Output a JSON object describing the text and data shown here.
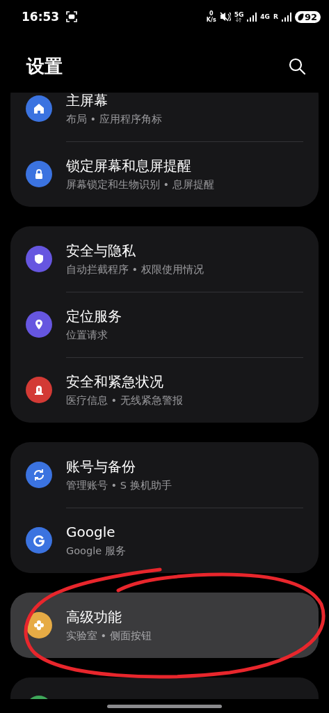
{
  "status_bar": {
    "time": "16:53",
    "speed_value": "0",
    "speed_unit": "K/s",
    "network_1": "5G",
    "network_2": "4G",
    "roaming": "R",
    "battery": "92"
  },
  "header": {
    "title": "设置"
  },
  "groups": [
    {
      "items": [
        {
          "title": "主屏幕",
          "subtitle": "布局 • 应用程序角标",
          "color": "#3b73e0",
          "selected": false
        },
        {
          "title": "锁定屏幕和息屏提醒",
          "subtitle": "屏幕锁定和生物识别 • 息屏提醒",
          "color": "#3b73e0",
          "selected": false
        }
      ]
    },
    {
      "items": [
        {
          "title": "安全与隐私",
          "subtitle": "自动拦截程序 • 权限使用情况",
          "color": "#6656e0",
          "selected": false
        },
        {
          "title": "定位服务",
          "subtitle": "位置请求",
          "color": "#6656e0",
          "selected": false
        },
        {
          "title": "安全和紧急状况",
          "subtitle": "医疗信息 • 无线紧急警报",
          "color": "#d33a35",
          "selected": false
        }
      ]
    },
    {
      "items": [
        {
          "title": "账号与备份",
          "subtitle": "管理账号 • S 换机助手",
          "color": "#3b73e0",
          "selected": false
        },
        {
          "title": "Google",
          "subtitle": "Google 服务",
          "color": "#3b73e0",
          "selected": false
        }
      ]
    },
    {
      "items": [
        {
          "title": "高级功能",
          "subtitle": "实验室 • 侧面按钮",
          "color": "#e6ab45",
          "selected": true
        }
      ]
    },
    {
      "items": [
        {
          "color": "#3fa85a",
          "selected": false
        }
      ]
    }
  ]
}
